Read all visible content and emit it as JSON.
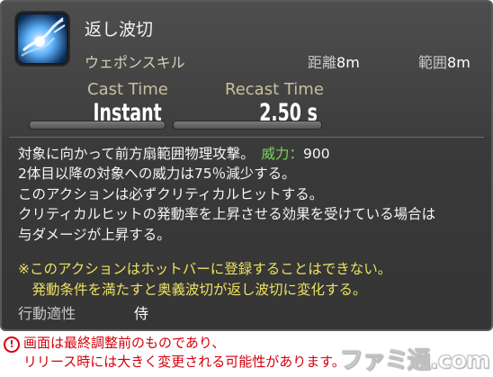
{
  "action": {
    "name": "返し波切",
    "category": "ウェポンスキル",
    "range_label": "距離",
    "range_value": "8m",
    "radius_label": "範囲",
    "radius_value": "8m",
    "cast_time_label": "Cast Time",
    "cast_time_value": "Instant",
    "recast_time_label": "Recast Time",
    "recast_time_value": "2.50 s"
  },
  "description": {
    "line1": "対象に向かって前方扇範囲物理攻撃。",
    "potency_label": "威力：",
    "potency_value": "900",
    "line2": "2体目以降の対象への威力は75％減少する。",
    "line3": "このアクションは必ずクリティカルヒットする。",
    "line4": "クリティカルヒットの発動率を上昇させる効果を受けている場合は",
    "line5": "与ダメージが上昇する。"
  },
  "notes": {
    "line1": "※このアクションはホットバーに登録することはできない。",
    "line2": "　発動条件を満たすと奥義波切が返し波切に変化する。"
  },
  "job": {
    "label": "行動適性",
    "value": "侍"
  },
  "disclaimer": {
    "icon": "!",
    "line1": "画面は最終調整前のものであり、",
    "line2": "リリース時には大きく変更される可能性があります。"
  },
  "watermark": "ファミ通.com",
  "colors": {
    "potency": "#7ed35a",
    "note": "#ece260",
    "warning": "#d4000c"
  }
}
